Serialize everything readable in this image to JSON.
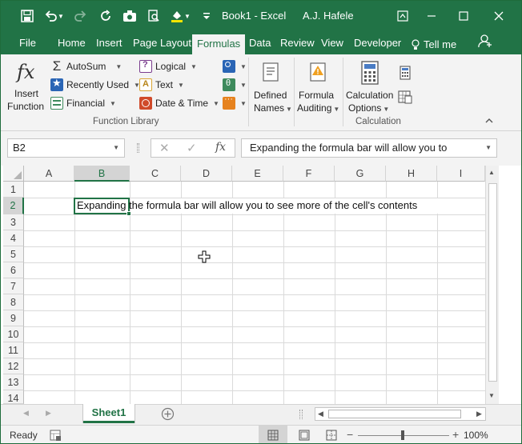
{
  "title_bar": {
    "doc_title": "Book1 - Excel",
    "user": "A.J. Hafele",
    "qat_icons": [
      "save-icon",
      "undo-icon",
      "redo-icon",
      "refresh-icon",
      "camera-icon",
      "print-preview-icon",
      "fill-color-icon"
    ],
    "window_controls": [
      "ribbon-display-icon",
      "minimize-icon",
      "maximize-icon",
      "close-icon"
    ]
  },
  "tabs": [
    {
      "label": "File"
    },
    {
      "label": "Home"
    },
    {
      "label": "Insert"
    },
    {
      "label": "Page Layout"
    },
    {
      "label": "Formulas",
      "active": true
    },
    {
      "label": "Data"
    },
    {
      "label": "Review"
    },
    {
      "label": "View"
    },
    {
      "label": "Developer"
    },
    {
      "label": "Tell me"
    }
  ],
  "ribbon": {
    "insert_function": {
      "line1": "Insert",
      "line2": "Function"
    },
    "autosum": "AutoSum",
    "recently_used": "Recently Used",
    "financial": "Financial",
    "logical": "Logical",
    "text": "Text",
    "date_time": "Date & Time",
    "defined_names": {
      "line1": "Defined",
      "line2": "Names"
    },
    "formula_auditing": {
      "line1": "Formula",
      "line2": "Auditing"
    },
    "calculation_options": {
      "line1": "Calculation",
      "line2": "Options"
    },
    "group_function_library": "Function Library",
    "group_calculation": "Calculation"
  },
  "formula_bar": {
    "name_box": "B2",
    "content": "Expanding the formula bar will allow you to"
  },
  "grid": {
    "columns": [
      "A",
      "B",
      "C",
      "D",
      "E",
      "F",
      "G",
      "H",
      "I"
    ],
    "rows": [
      "1",
      "2",
      "3",
      "4",
      "5",
      "6",
      "7",
      "8",
      "9",
      "10",
      "11",
      "12",
      "13",
      "14"
    ],
    "selected_column": "B",
    "selected_row": "2",
    "cell_b2": "Expanding the formula bar will allow you to see more of the cell's contents"
  },
  "sheets": {
    "active": "Sheet1"
  },
  "status": {
    "mode": "Ready",
    "zoom": "100%",
    "zoom_level": 1.0
  },
  "colors": {
    "accent": "#217346"
  }
}
